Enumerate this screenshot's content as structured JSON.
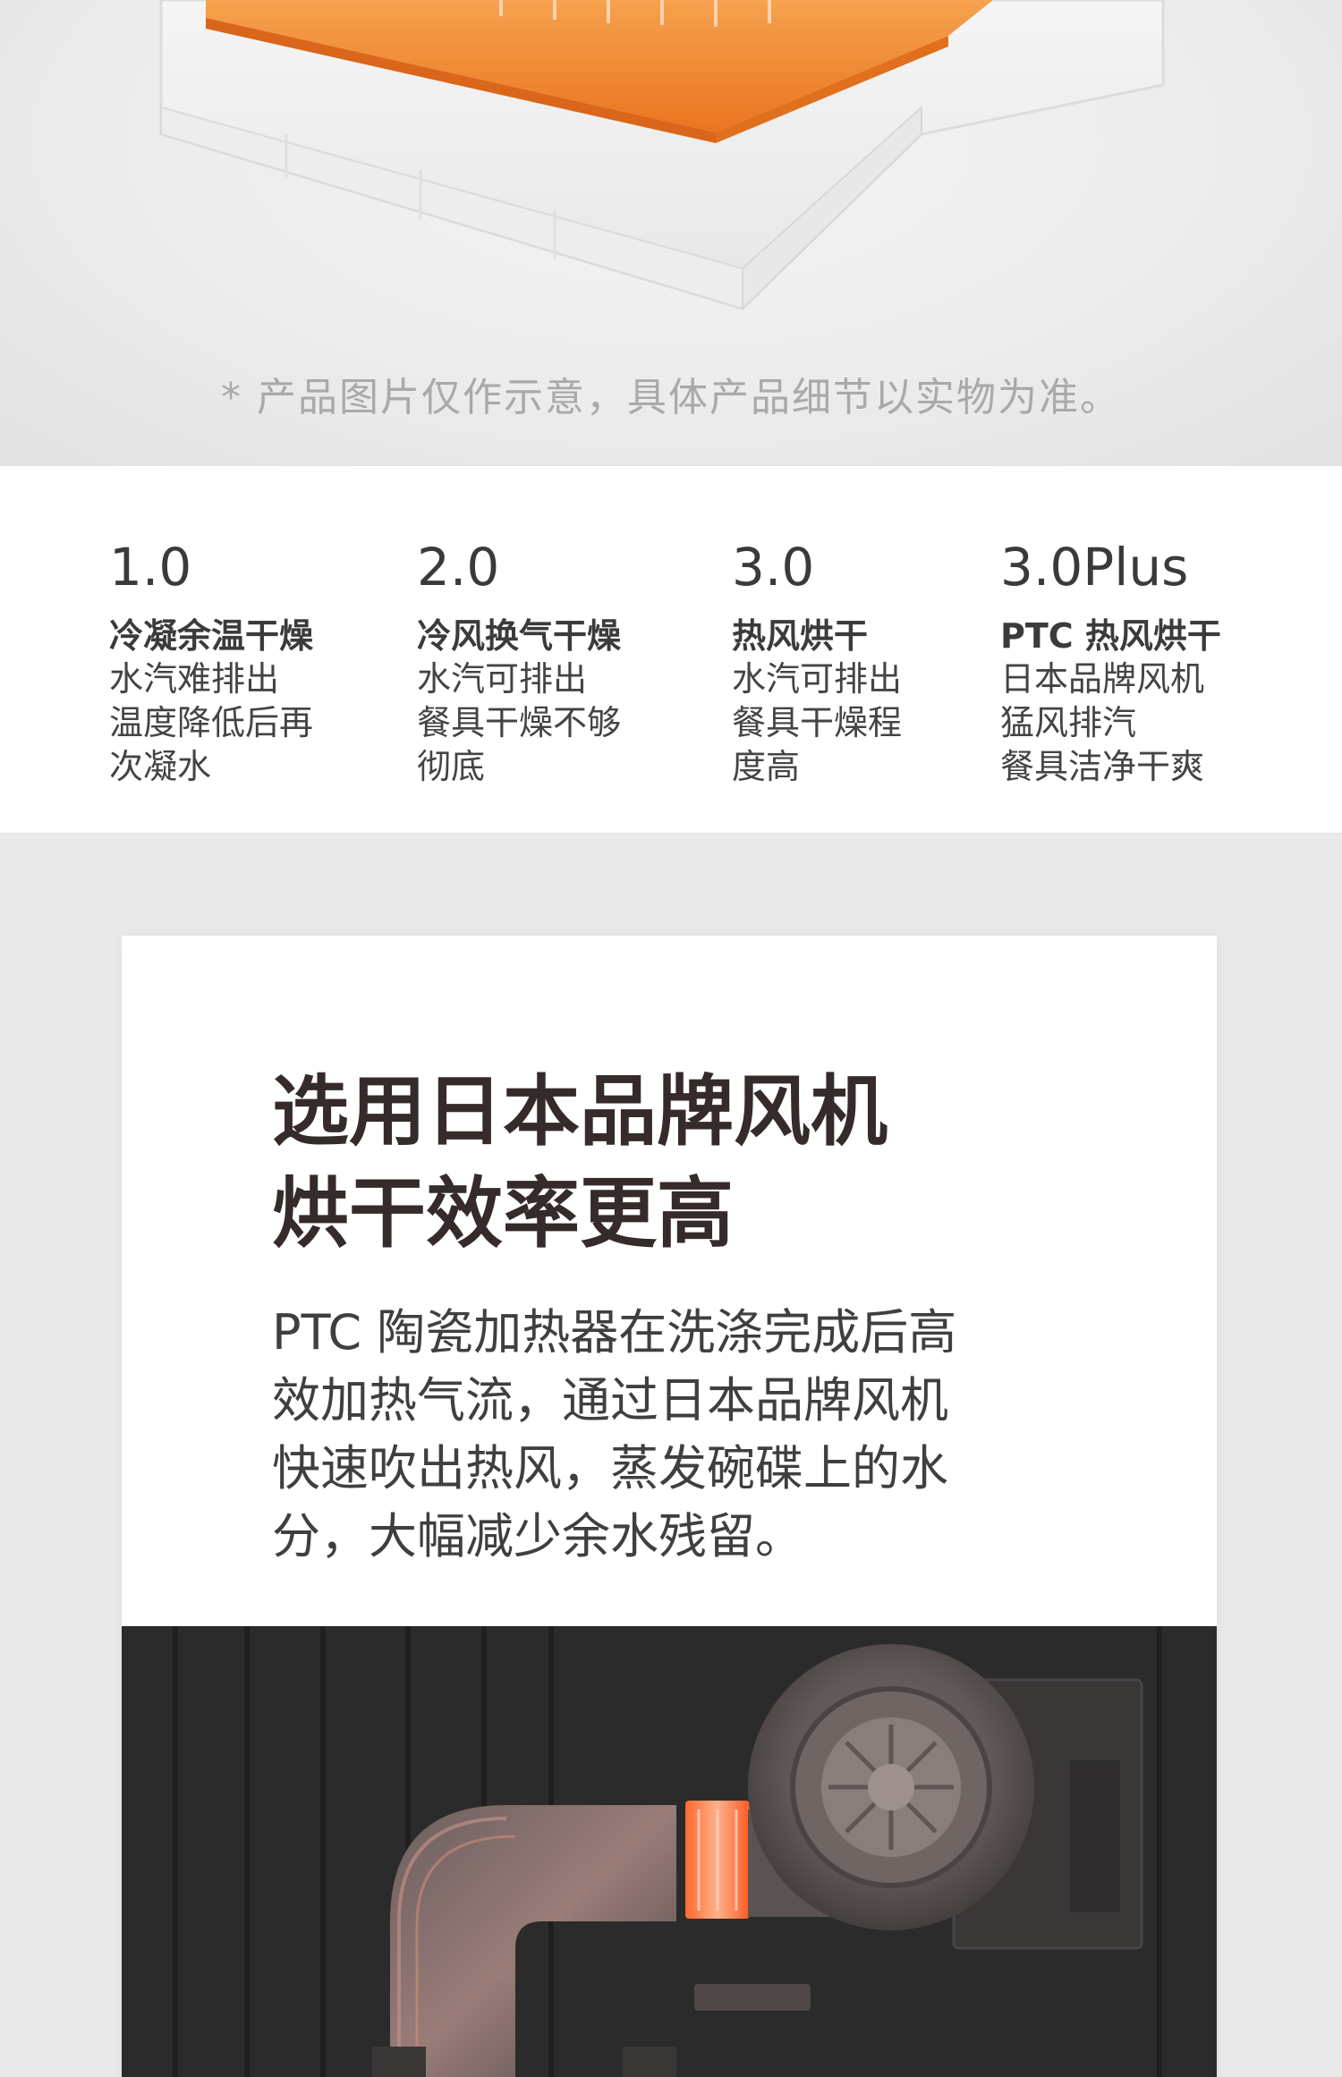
{
  "disclaimer": "* 产品图片仅作示意，具体产品细节以实物为准。",
  "generations": [
    {
      "version": "1.0",
      "name": "冷凝余温干燥",
      "lines": [
        "水汽难排出",
        "温度降低后再",
        "次凝水"
      ]
    },
    {
      "version": "2.0",
      "name": "冷风换气干燥",
      "lines": [
        "水汽可排出",
        "餐具干燥不够",
        "彻底"
      ]
    },
    {
      "version": "3.0",
      "name": "热风烘干",
      "lines": [
        "水汽可排出",
        "餐具干燥程",
        "度高"
      ]
    },
    {
      "version": "3.0Plus",
      "name": "PTC 热风烘干",
      "lines": [
        "日本品牌风机",
        "猛风排汽",
        "餐具洁净干爽"
      ]
    }
  ],
  "feature": {
    "title_lines": [
      "选用日本品牌风机",
      "烘干效率更高"
    ],
    "desc_lines": [
      "PTC 陶瓷加热器在洗涤完成后高",
      "效加热气流，通过日本品牌风机",
      "快速吹出热风，蒸发碗碟上的水",
      "分，大幅减少余水残留。"
    ]
  },
  "colors": {
    "accent_orange": "#f07f2a",
    "heater_red": "#ff5a2a",
    "title_dark": "#352b2a"
  },
  "icons": {
    "product": "dishwasher-drawer-illustration",
    "fan": "blower-fan-illustration"
  }
}
